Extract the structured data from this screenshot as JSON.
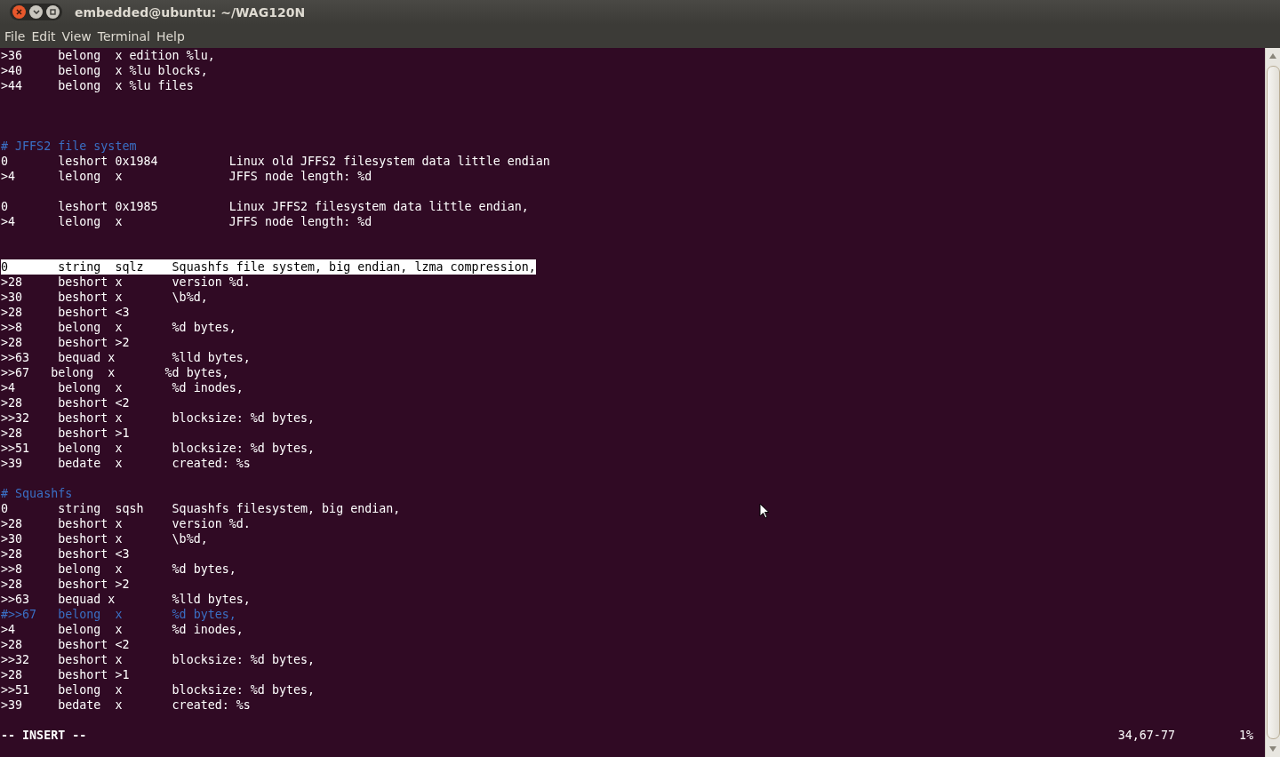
{
  "window": {
    "title": "embedded@ubuntu: ~/WAG120N"
  },
  "menu": [
    "File",
    "Edit",
    "View",
    "Terminal",
    "Help"
  ],
  "lines": [
    {
      "kind": "text",
      "text": ">36     belong  x edition %lu,"
    },
    {
      "kind": "text",
      "text": ">40     belong  x %lu blocks,"
    },
    {
      "kind": "text",
      "text": ">44     belong  x %lu files"
    },
    {
      "kind": "blank"
    },
    {
      "kind": "blank"
    },
    {
      "kind": "blank"
    },
    {
      "kind": "comment",
      "text": "# JFFS2 file system"
    },
    {
      "kind": "text",
      "text": "0       leshort 0x1984          Linux old JFFS2 filesystem data little endian"
    },
    {
      "kind": "text",
      "text": ">4      lelong  x               JFFS node length: %d"
    },
    {
      "kind": "blank"
    },
    {
      "kind": "text",
      "text": "0       leshort 0x1985          Linux JFFS2 filesystem data little endian,"
    },
    {
      "kind": "text",
      "text": ">4      lelong  x               JFFS node length: %d"
    },
    {
      "kind": "blank"
    },
    {
      "kind": "blank"
    },
    {
      "kind": "highlighted",
      "text": "0       string  sqlz    Squashfs file system, big endian, lzma compression,"
    },
    {
      "kind": "text",
      "text": ">28     beshort x       version %d."
    },
    {
      "kind": "text",
      "text": ">30     beshort x       \\b%d,"
    },
    {
      "kind": "text",
      "text": ">28     beshort <3"
    },
    {
      "kind": "text",
      "text": ">>8     belong  x       %d bytes,"
    },
    {
      "kind": "text",
      "text": ">28     beshort >2"
    },
    {
      "kind": "text",
      "text": ">>63    bequad x        %lld bytes,"
    },
    {
      "kind": "text",
      "text": ">>67   belong  x       %d bytes,"
    },
    {
      "kind": "text",
      "text": ">4      belong  x       %d inodes,"
    },
    {
      "kind": "text",
      "text": ">28     beshort <2"
    },
    {
      "kind": "text",
      "text": ">>32    beshort x       blocksize: %d bytes,"
    },
    {
      "kind": "text",
      "text": ">28     beshort >1"
    },
    {
      "kind": "text",
      "text": ">>51    belong  x       blocksize: %d bytes,"
    },
    {
      "kind": "text",
      "text": ">39     bedate  x       created: %s"
    },
    {
      "kind": "blank"
    },
    {
      "kind": "comment",
      "text": "# Squashfs"
    },
    {
      "kind": "text",
      "text": "0       string  sqsh    Squashfs filesystem, big endian,"
    },
    {
      "kind": "text",
      "text": ">28     beshort x       version %d."
    },
    {
      "kind": "text",
      "text": ">30     beshort x       \\b%d,"
    },
    {
      "kind": "text",
      "text": ">28     beshort <3"
    },
    {
      "kind": "text",
      "text": ">>8     belong  x       %d bytes,"
    },
    {
      "kind": "text",
      "text": ">28     beshort >2"
    },
    {
      "kind": "text",
      "text": ">>63    bequad x        %lld bytes,"
    },
    {
      "kind": "comment",
      "text": "#>>67   belong  x       %d bytes,"
    },
    {
      "kind": "text",
      "text": ">4      belong  x       %d inodes,"
    },
    {
      "kind": "text",
      "text": ">28     beshort <2"
    },
    {
      "kind": "text",
      "text": ">>32    beshort x       blocksize: %d bytes,"
    },
    {
      "kind": "text",
      "text": ">28     beshort >1"
    },
    {
      "kind": "text",
      "text": ">>51    belong  x       blocksize: %d bytes,"
    },
    {
      "kind": "text",
      "text": ">39     bedate  x       created: %s"
    },
    {
      "kind": "blank"
    }
  ],
  "status_line": {
    "mode": "-- INSERT --",
    "position": "34,67-77",
    "percent": "1%"
  }
}
